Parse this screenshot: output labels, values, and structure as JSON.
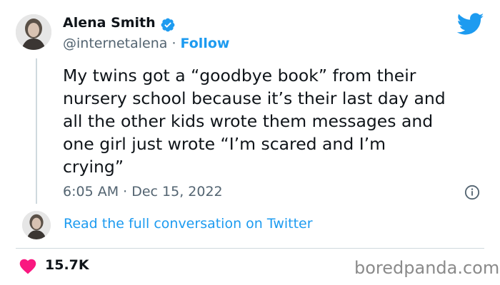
{
  "tweet": {
    "author": {
      "name": "Alena Smith",
      "handle": "@internetalena",
      "separator": " · ",
      "follow_label": "Follow",
      "verified": true
    },
    "text": "My twins got a “goodbye book” from their\nnursery school because it’s their last day and\nall the other kids wrote them messages and\none girl just wrote “I’m scared and I’m\ncrying”",
    "timestamp": "6:05 AM · Dec 15, 2022",
    "read_full_label": "Read the full conversation on Twitter",
    "likes": "15.7K"
  },
  "watermark": "boredpanda.com",
  "icons": {
    "logo": "twitter-bird-icon",
    "verified": "verified-badge-icon",
    "info": "info-icon",
    "like": "heart-icon"
  },
  "colors": {
    "accent": "#1d9bf0",
    "text": "#0f1419",
    "secondary": "#536471",
    "like": "#f91880",
    "divider": "#cfd9de"
  }
}
